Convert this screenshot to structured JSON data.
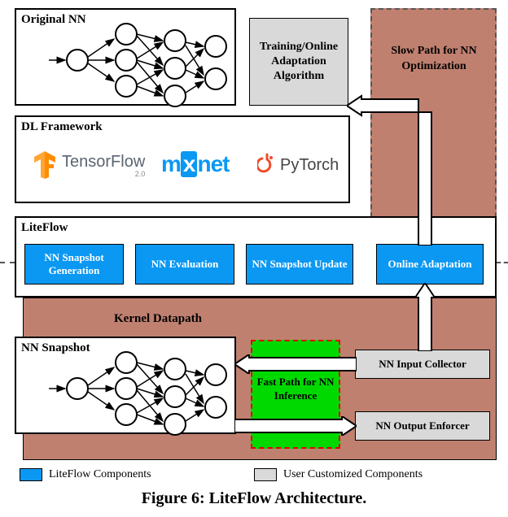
{
  "originalNN": {
    "title": "Original NN"
  },
  "dlFramework": {
    "title": "DL Framework",
    "tensorflow": {
      "name": "TensorFlow",
      "sub": "2.0"
    },
    "mxnet": {
      "prefix": "m",
      "x": "x",
      "suffix": "net"
    },
    "pytorch": {
      "name": "PyTorch"
    }
  },
  "trainingBox": "Training/Online Adaptation Algorithm",
  "slowPath": "Slow Path for NN Optimization",
  "liteflow": {
    "title": "LiteFlow",
    "btn1": "NN Snapshot Generation",
    "btn2": "NN Evaluation",
    "btn3": "NN Snapshot Update",
    "btn4": "Online Adaptation"
  },
  "kernelDatapath": "Kernel Datapath",
  "nnSnapshot": {
    "title": "NN Snapshot"
  },
  "fastPath": "Fast Path for NN Inference",
  "inputCollector": "NN Input Collector",
  "outputEnforcer": "NN Output Enforcer",
  "legend": {
    "liteflow": "LiteFlow Components",
    "user": "User Customized Components"
  },
  "caption": "Figure 6: LiteFlow Architecture.",
  "colors": {
    "salmon": "#c08070",
    "blue": "#0b98f2",
    "green": "#00d900",
    "grey": "#d9d9d9",
    "tf_orange": "#ff8c00",
    "mxnet_blue": "#0b98f2",
    "pytorch_orange": "#ee4c2c"
  }
}
